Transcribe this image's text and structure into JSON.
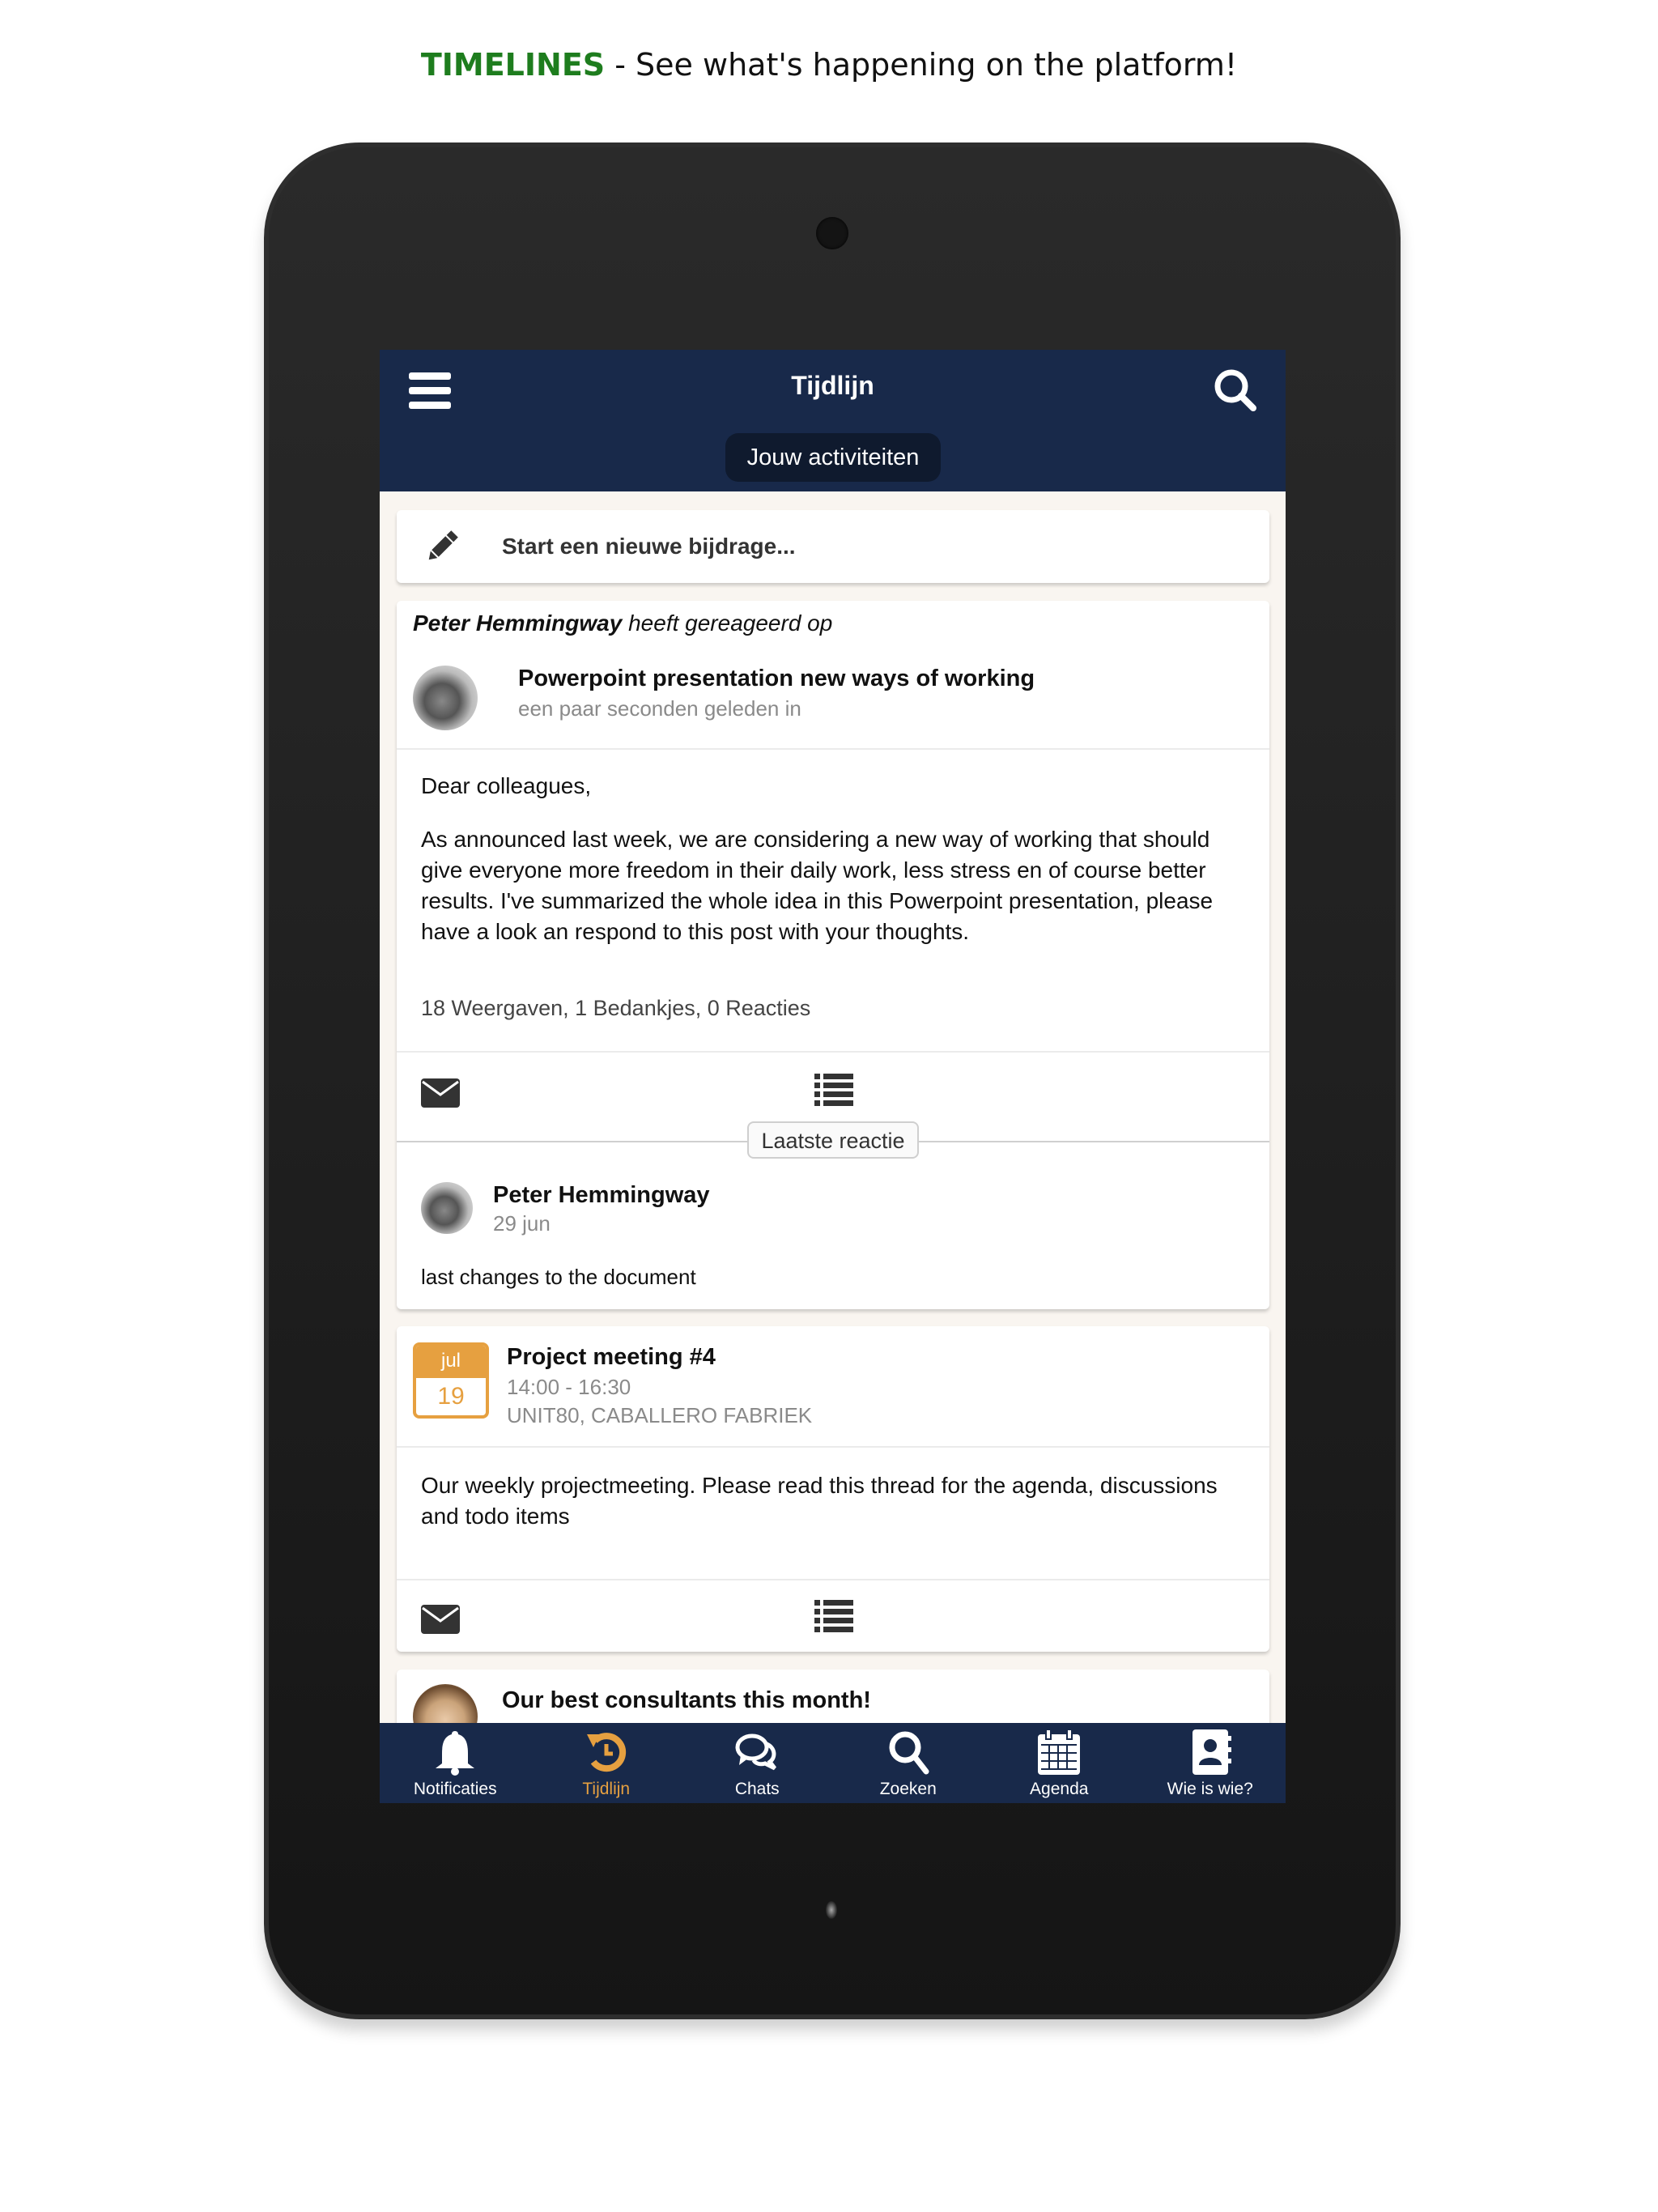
{
  "headline": {
    "brand": "TIMELINES",
    "rest": " - See what's happening on the platform!",
    "brand_color": "#1e7d1e"
  },
  "appbar": {
    "title": "Tijdlijn",
    "filter_pill": "Jouw activiteiten",
    "menu_icon": "hamburger-menu-icon",
    "search_icon": "search-icon",
    "bg_color": "#18294a"
  },
  "compose": {
    "label": "Start een nieuwe bijdrage...",
    "icon": "pencil-icon"
  },
  "posts": [
    {
      "actor_name": "Peter Hemmingway",
      "actor_action": " heeft gereageerd op",
      "title": "Powerpoint presentation new ways of working",
      "subtitle": "een paar seconden geleden in",
      "greeting": "Dear colleagues,",
      "body": "As announced last week, we are considering a new way of working that should give everyone more freedom in their daily work, less stress en of course better results. I've summarized the whole idea in this Powerpoint presentation, please have a look an respond to this post with your thoughts.",
      "stats": "18 Weergaven, 1 Bedankjes, 0 Reacties",
      "latest_label": "Laatste reactie",
      "latest_reply": {
        "name": "Peter Hemmingway",
        "date": "29 jun",
        "text": "last changes to the document"
      }
    }
  ],
  "event": {
    "month": "jul",
    "day": "19",
    "title": "Project meeting #4",
    "time": "14:00 - 16:30",
    "location": "UNIT80, CABALLERO FABRIEK",
    "body": "Our weekly projectmeeting. Please read this thread for the agenda, discussions and todo items",
    "accent_color": "#e6a040"
  },
  "third_post": {
    "title": "Our best consultants this month!"
  },
  "bottom_nav": {
    "active": "Tijdlijn",
    "active_color": "#e6a040",
    "items": [
      {
        "label": "Notificaties",
        "icon": "bell-icon"
      },
      {
        "label": "Tijdlijn",
        "icon": "history-icon"
      },
      {
        "label": "Chats",
        "icon": "chat-bubbles-icon"
      },
      {
        "label": "Zoeken",
        "icon": "search-icon"
      },
      {
        "label": "Agenda",
        "icon": "calendar-icon"
      },
      {
        "label": "Wie is wie?",
        "icon": "contact-book-icon"
      }
    ]
  }
}
